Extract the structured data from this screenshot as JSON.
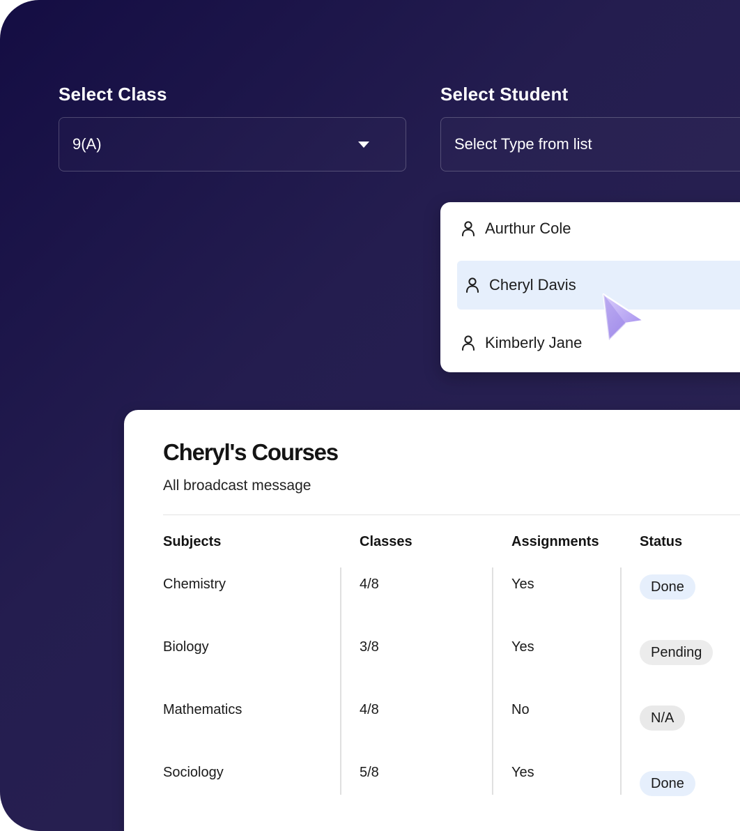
{
  "form": {
    "class_label": "Select Class",
    "class_value": "9(A)",
    "student_label": "Select Student",
    "student_placeholder": "Select Type from list"
  },
  "dropdown": {
    "items": [
      {
        "name": "Aurthur Cole",
        "selected": false
      },
      {
        "name": "Cheryl Davis",
        "selected": true
      },
      {
        "name": "Kimberly Jane",
        "selected": false
      }
    ]
  },
  "courses": {
    "title": "Cheryl's Courses",
    "subtitle": "All broadcast message",
    "headers": [
      "Subjects",
      "Classes",
      "Assignments",
      "Status"
    ],
    "rows": [
      {
        "subject": "Chemistry",
        "classes": "4/8",
        "assignments": "Yes",
        "status": "Done"
      },
      {
        "subject": "Biology",
        "classes": "3/8",
        "assignments": "Yes",
        "status": "Pending"
      },
      {
        "subject": "Mathematics",
        "classes": "4/8",
        "assignments": "No",
        "status": "N/A"
      },
      {
        "subject": "Sociology",
        "classes": "5/8",
        "assignments": "Yes",
        "status": "Done"
      }
    ]
  },
  "colors": {
    "background_start": "#140d43",
    "background_end": "#2b2453",
    "selected_row": "#e6effc",
    "status_done": "#e6effc",
    "status_pending": "#ececec",
    "status_na": "#e9e9e9",
    "cursor": "#b7a6f2"
  },
  "icons": {
    "dropdown_caret": "caret-down-icon",
    "student": "user-icon",
    "pointer": "cursor-arrow-icon"
  }
}
